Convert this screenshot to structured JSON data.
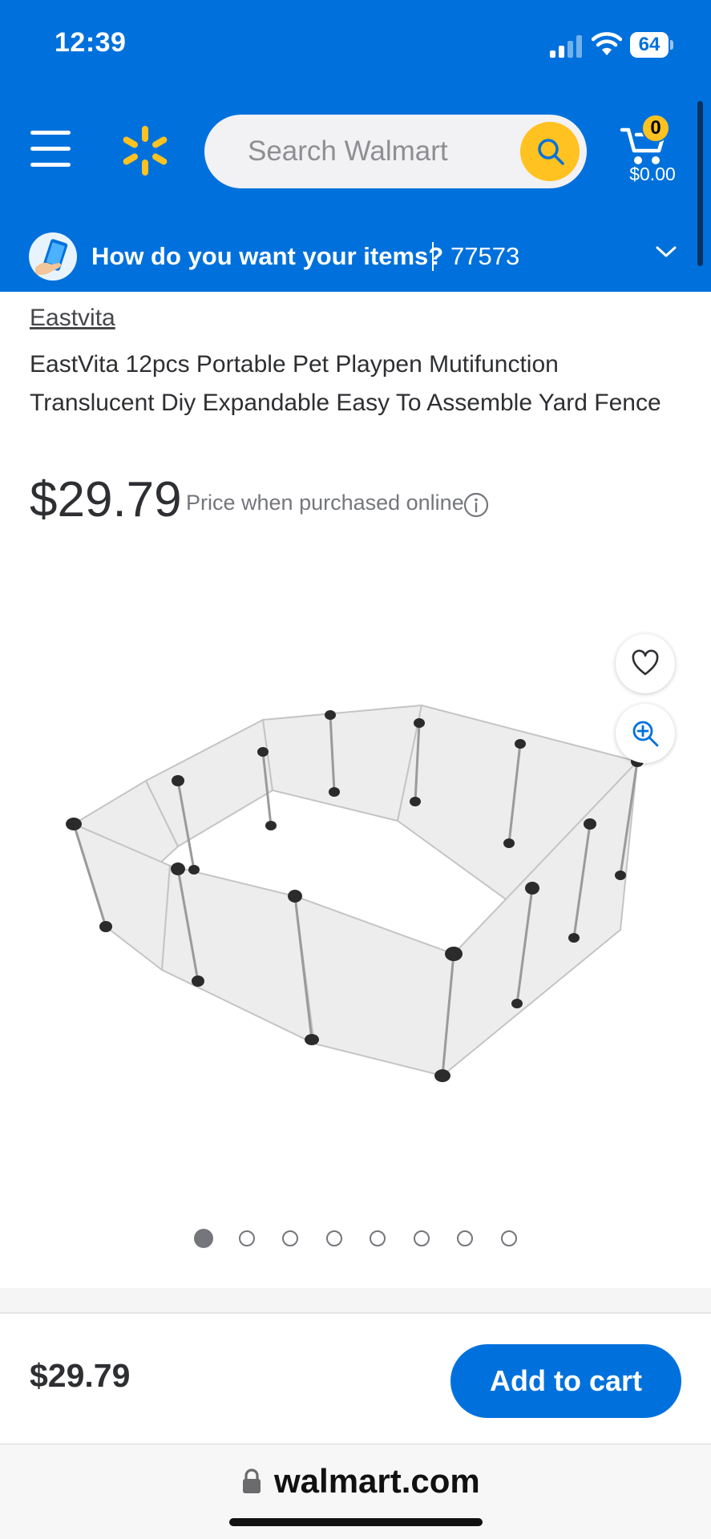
{
  "status_bar": {
    "time": "12:39",
    "battery": "64"
  },
  "header": {
    "search_placeholder": "Search Walmart",
    "cart_count": "0",
    "cart_total": "$0.00",
    "colors": {
      "brand_blue": "#0071dc",
      "spark_yellow": "#ffc220"
    }
  },
  "delivery": {
    "question": "How do you want your items?",
    "zip": "77573"
  },
  "product": {
    "brand": "Eastvita",
    "title": "EastVita 12pcs Portable Pet Playpen Mutifunction Translucent Diy Expandable Easy To Assemble Yard Fence",
    "price": "$29.79",
    "price_note": "Price when purchased online",
    "image_alt": "EastVita 12pcs Portable Pet Playpen",
    "carousel": {
      "total": 8,
      "active": 1
    }
  },
  "sticky_bar": {
    "price": "$29.79",
    "add_to_cart": "Add to cart"
  },
  "browser": {
    "url": "walmart.com"
  }
}
